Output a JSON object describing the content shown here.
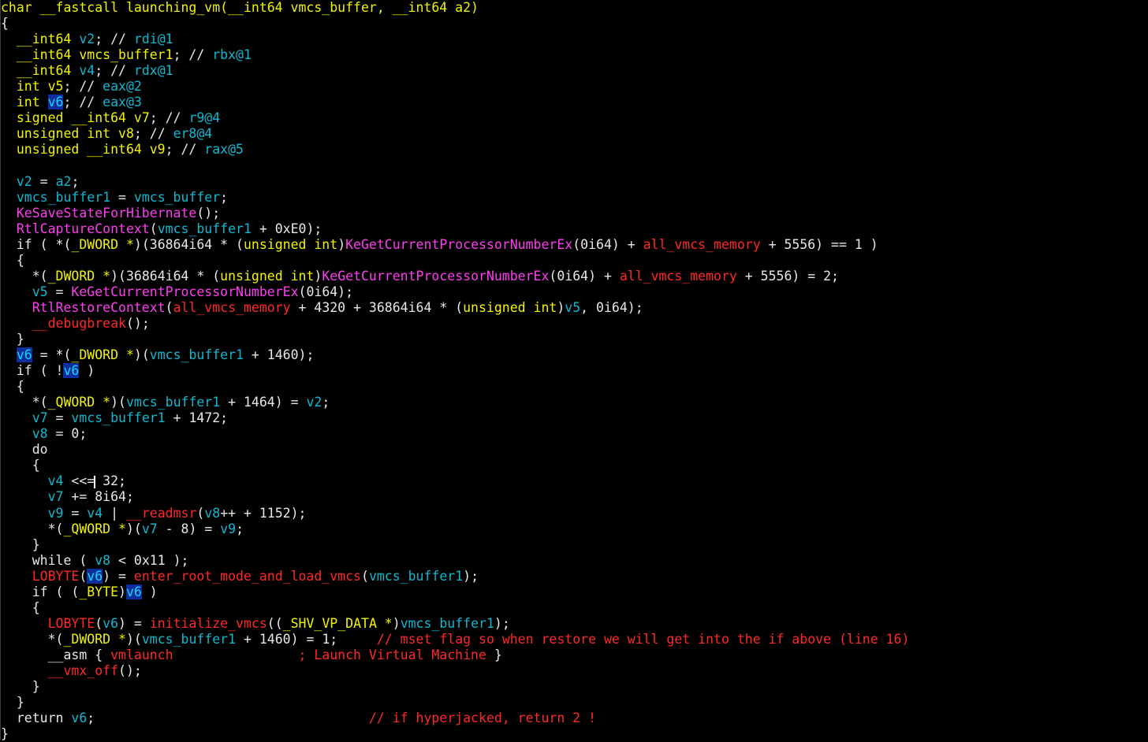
{
  "colors": {
    "background": "#000000",
    "keyword_type": "#f3f300",
    "plain_text": "#e8e8e8",
    "variable": "#10b8d0",
    "function": "#ff3cf0",
    "global_or_intrinsic": "#ff2828",
    "highlight_bg": "#0e2ea0"
  },
  "lines": [
    [
      {
        "t": "char __fastcall launching_vm(__int64 vmcs_buffer, __int64 a2)",
        "c": "yel"
      }
    ],
    [
      {
        "t": "{",
        "c": "wht"
      }
    ],
    [
      {
        "t": "  __int64 ",
        "c": "yel"
      },
      {
        "t": "v2",
        "c": "cya"
      },
      {
        "t": "; // ",
        "c": "wht"
      },
      {
        "t": "rdi@1",
        "c": "cya"
      }
    ],
    [
      {
        "t": "  __int64 ",
        "c": "yel"
      },
      {
        "t": "vmcs_buffer1",
        "c": "yel"
      },
      {
        "t": "; // ",
        "c": "wht"
      },
      {
        "t": "rbx@1",
        "c": "cya"
      }
    ],
    [
      {
        "t": "  __int64 ",
        "c": "yel"
      },
      {
        "t": "v4",
        "c": "cya"
      },
      {
        "t": "; // ",
        "c": "wht"
      },
      {
        "t": "rdx@1",
        "c": "cya"
      }
    ],
    [
      {
        "t": "  int ",
        "c": "yel"
      },
      {
        "t": "v5",
        "c": "yel"
      },
      {
        "t": "; // ",
        "c": "wht"
      },
      {
        "t": "eax@2",
        "c": "cya"
      }
    ],
    [
      {
        "t": "  int ",
        "c": "yel"
      },
      {
        "t": "v6",
        "c": "hl"
      },
      {
        "t": "; // ",
        "c": "wht"
      },
      {
        "t": "eax@3",
        "c": "cya"
      }
    ],
    [
      {
        "t": "  signed __int64 ",
        "c": "yel"
      },
      {
        "t": "v7",
        "c": "yel"
      },
      {
        "t": "; // ",
        "c": "wht"
      },
      {
        "t": "r9@4",
        "c": "cya"
      }
    ],
    [
      {
        "t": "  unsigned int ",
        "c": "yel"
      },
      {
        "t": "v8",
        "c": "yel"
      },
      {
        "t": "; // ",
        "c": "wht"
      },
      {
        "t": "er8@4",
        "c": "cya"
      }
    ],
    [
      {
        "t": "  unsigned __int64 ",
        "c": "yel"
      },
      {
        "t": "v9",
        "c": "yel"
      },
      {
        "t": "; // ",
        "c": "wht"
      },
      {
        "t": "rax@5",
        "c": "cya"
      }
    ],
    [
      {
        "t": "",
        "c": "wht"
      }
    ],
    [
      {
        "t": "  v2",
        "c": "cya"
      },
      {
        "t": " = ",
        "c": "wht"
      },
      {
        "t": "a2",
        "c": "cya"
      },
      {
        "t": ";",
        "c": "wht"
      }
    ],
    [
      {
        "t": "  vmcs_buffer1",
        "c": "cya"
      },
      {
        "t": " = ",
        "c": "wht"
      },
      {
        "t": "vmcs_buffer",
        "c": "cya"
      },
      {
        "t": ";",
        "c": "wht"
      }
    ],
    [
      {
        "t": "  KeSaveStateForHibernate",
        "c": "mag"
      },
      {
        "t": "();",
        "c": "wht"
      }
    ],
    [
      {
        "t": "  RtlCaptureContext",
        "c": "mag"
      },
      {
        "t": "(",
        "c": "wht"
      },
      {
        "t": "vmcs_buffer1",
        "c": "cya"
      },
      {
        "t": " + 0xE0);",
        "c": "wht"
      }
    ],
    [
      {
        "t": "  if ( *(",
        "c": "wht"
      },
      {
        "t": "_DWORD *",
        "c": "yel"
      },
      {
        "t": ")(36864i64 * (",
        "c": "wht"
      },
      {
        "t": "unsigned int",
        "c": "yel"
      },
      {
        "t": ")",
        "c": "wht"
      },
      {
        "t": "KeGetCurrentProcessorNumberEx",
        "c": "mag"
      },
      {
        "t": "(0i64) + ",
        "c": "wht"
      },
      {
        "t": "all_vmcs_memory",
        "c": "red"
      },
      {
        "t": " + 5556) == 1 )",
        "c": "wht"
      }
    ],
    [
      {
        "t": "  {",
        "c": "wht"
      }
    ],
    [
      {
        "t": "    *(",
        "c": "wht"
      },
      {
        "t": "_DWORD *",
        "c": "yel"
      },
      {
        "t": ")(36864i64 * (",
        "c": "wht"
      },
      {
        "t": "unsigned int",
        "c": "yel"
      },
      {
        "t": ")",
        "c": "wht"
      },
      {
        "t": "KeGetCurrentProcessorNumberEx",
        "c": "mag"
      },
      {
        "t": "(0i64) + ",
        "c": "wht"
      },
      {
        "t": "all_vmcs_memory",
        "c": "red"
      },
      {
        "t": " + 5556) = 2;",
        "c": "wht"
      }
    ],
    [
      {
        "t": "    v5",
        "c": "cya"
      },
      {
        "t": " = ",
        "c": "wht"
      },
      {
        "t": "KeGetCurrentProcessorNumberEx",
        "c": "mag"
      },
      {
        "t": "(0i64);",
        "c": "wht"
      }
    ],
    [
      {
        "t": "    RtlRestoreContext",
        "c": "mag"
      },
      {
        "t": "(",
        "c": "wht"
      },
      {
        "t": "all_vmcs_memory",
        "c": "red"
      },
      {
        "t": " + 4320 + 36864i64 * (",
        "c": "wht"
      },
      {
        "t": "unsigned int",
        "c": "yel"
      },
      {
        "t": ")",
        "c": "wht"
      },
      {
        "t": "v5",
        "c": "cya"
      },
      {
        "t": ", 0i64);",
        "c": "wht"
      }
    ],
    [
      {
        "t": "    __debugbreak",
        "c": "red"
      },
      {
        "t": "();",
        "c": "wht"
      }
    ],
    [
      {
        "t": "  }",
        "c": "wht"
      }
    ],
    [
      {
        "t": "  ",
        "c": "wht"
      },
      {
        "t": "v6",
        "c": "hl"
      },
      {
        "t": " = *(",
        "c": "wht"
      },
      {
        "t": "_DWORD *",
        "c": "yel"
      },
      {
        "t": ")(",
        "c": "wht"
      },
      {
        "t": "vmcs_buffer1",
        "c": "cya"
      },
      {
        "t": " + 1460);",
        "c": "wht"
      }
    ],
    [
      {
        "t": "  if ( !",
        "c": "wht"
      },
      {
        "t": "v6",
        "c": "hl"
      },
      {
        "t": " )",
        "c": "wht"
      }
    ],
    [
      {
        "t": "  {",
        "c": "wht"
      }
    ],
    [
      {
        "t": "    *(",
        "c": "wht"
      },
      {
        "t": "_QWORD *",
        "c": "yel"
      },
      {
        "t": ")(",
        "c": "wht"
      },
      {
        "t": "vmcs_buffer1",
        "c": "cya"
      },
      {
        "t": " + 1464) = ",
        "c": "wht"
      },
      {
        "t": "v2",
        "c": "cya"
      },
      {
        "t": ";",
        "c": "wht"
      }
    ],
    [
      {
        "t": "    v7",
        "c": "cya"
      },
      {
        "t": " = ",
        "c": "wht"
      },
      {
        "t": "vmcs_buffer1",
        "c": "cya"
      },
      {
        "t": " + 1472;",
        "c": "wht"
      }
    ],
    [
      {
        "t": "    v8",
        "c": "cya"
      },
      {
        "t": " = 0;",
        "c": "wht"
      }
    ],
    [
      {
        "t": "    do",
        "c": "wht"
      }
    ],
    [
      {
        "t": "    {",
        "c": "wht"
      }
    ],
    [
      {
        "t": "      v4",
        "c": "cya"
      },
      {
        "t": " <<=",
        "c": "wht"
      },
      {
        "t": "|",
        "c": "caret"
      },
      {
        "t": " 32;",
        "c": "wht"
      }
    ],
    [
      {
        "t": "      v7",
        "c": "cya"
      },
      {
        "t": " += 8i64;",
        "c": "wht"
      }
    ],
    [
      {
        "t": "      v9",
        "c": "cya"
      },
      {
        "t": " = ",
        "c": "wht"
      },
      {
        "t": "v4",
        "c": "cya"
      },
      {
        "t": " | ",
        "c": "wht"
      },
      {
        "t": "__readmsr",
        "c": "red"
      },
      {
        "t": "(",
        "c": "wht"
      },
      {
        "t": "v8",
        "c": "cya"
      },
      {
        "t": "++ + 1152);",
        "c": "wht"
      }
    ],
    [
      {
        "t": "      *(",
        "c": "wht"
      },
      {
        "t": "_QWORD *",
        "c": "yel"
      },
      {
        "t": ")(",
        "c": "wht"
      },
      {
        "t": "v7",
        "c": "cya"
      },
      {
        "t": " - 8) = ",
        "c": "wht"
      },
      {
        "t": "v9",
        "c": "cya"
      },
      {
        "t": ";",
        "c": "wht"
      }
    ],
    [
      {
        "t": "    }",
        "c": "wht"
      }
    ],
    [
      {
        "t": "    while ( ",
        "c": "wht"
      },
      {
        "t": "v8",
        "c": "cya"
      },
      {
        "t": " < 0x11 );",
        "c": "wht"
      }
    ],
    [
      {
        "t": "    LOBYTE",
        "c": "red"
      },
      {
        "t": "(",
        "c": "wht"
      },
      {
        "t": "v6",
        "c": "hl"
      },
      {
        "t": ") = ",
        "c": "wht"
      },
      {
        "t": "enter_root_mode_and_load_vmcs",
        "c": "red"
      },
      {
        "t": "(",
        "c": "wht"
      },
      {
        "t": "vmcs_buffer1",
        "c": "cya"
      },
      {
        "t": ");",
        "c": "wht"
      }
    ],
    [
      {
        "t": "    if ( (",
        "c": "wht"
      },
      {
        "t": "_BYTE",
        "c": "yel"
      },
      {
        "t": ")",
        "c": "wht"
      },
      {
        "t": "v6",
        "c": "hl"
      },
      {
        "t": " )",
        "c": "wht"
      }
    ],
    [
      {
        "t": "    {",
        "c": "wht"
      }
    ],
    [
      {
        "t": "      LOBYTE",
        "c": "red"
      },
      {
        "t": "(",
        "c": "wht"
      },
      {
        "t": "v6",
        "c": "cya"
      },
      {
        "t": ") = ",
        "c": "wht"
      },
      {
        "t": "initialize_vmcs",
        "c": "red"
      },
      {
        "t": "((",
        "c": "wht"
      },
      {
        "t": "_SHV_VP_DATA *",
        "c": "yel"
      },
      {
        "t": ")",
        "c": "wht"
      },
      {
        "t": "vmcs_buffer1",
        "c": "cya"
      },
      {
        "t": ");",
        "c": "wht"
      }
    ],
    [
      {
        "t": "      *(",
        "c": "wht"
      },
      {
        "t": "_DWORD *",
        "c": "yel"
      },
      {
        "t": ")(",
        "c": "wht"
      },
      {
        "t": "vmcs_buffer1",
        "c": "cya"
      },
      {
        "t": " + 1460) = 1;     ",
        "c": "wht"
      },
      {
        "t": "// mset flag so when restore we will get into the if above (line 16)",
        "c": "red"
      }
    ],
    [
      {
        "t": "      __asm { ",
        "c": "wht"
      },
      {
        "t": "vmlaunch                ; Launch Virtual Machine",
        "c": "red"
      },
      {
        "t": " }",
        "c": "wht"
      }
    ],
    [
      {
        "t": "      __vmx_off",
        "c": "red"
      },
      {
        "t": "();",
        "c": "wht"
      }
    ],
    [
      {
        "t": "    }",
        "c": "wht"
      }
    ],
    [
      {
        "t": "  }",
        "c": "wht"
      }
    ],
    [
      {
        "t": "  return ",
        "c": "wht"
      },
      {
        "t": "v6",
        "c": "cya"
      },
      {
        "t": ";                                   ",
        "c": "wht"
      },
      {
        "t": "// if hyperjacked, return 2 !",
        "c": "red"
      }
    ],
    [
      {
        "t": "}",
        "c": "wht"
      }
    ]
  ]
}
